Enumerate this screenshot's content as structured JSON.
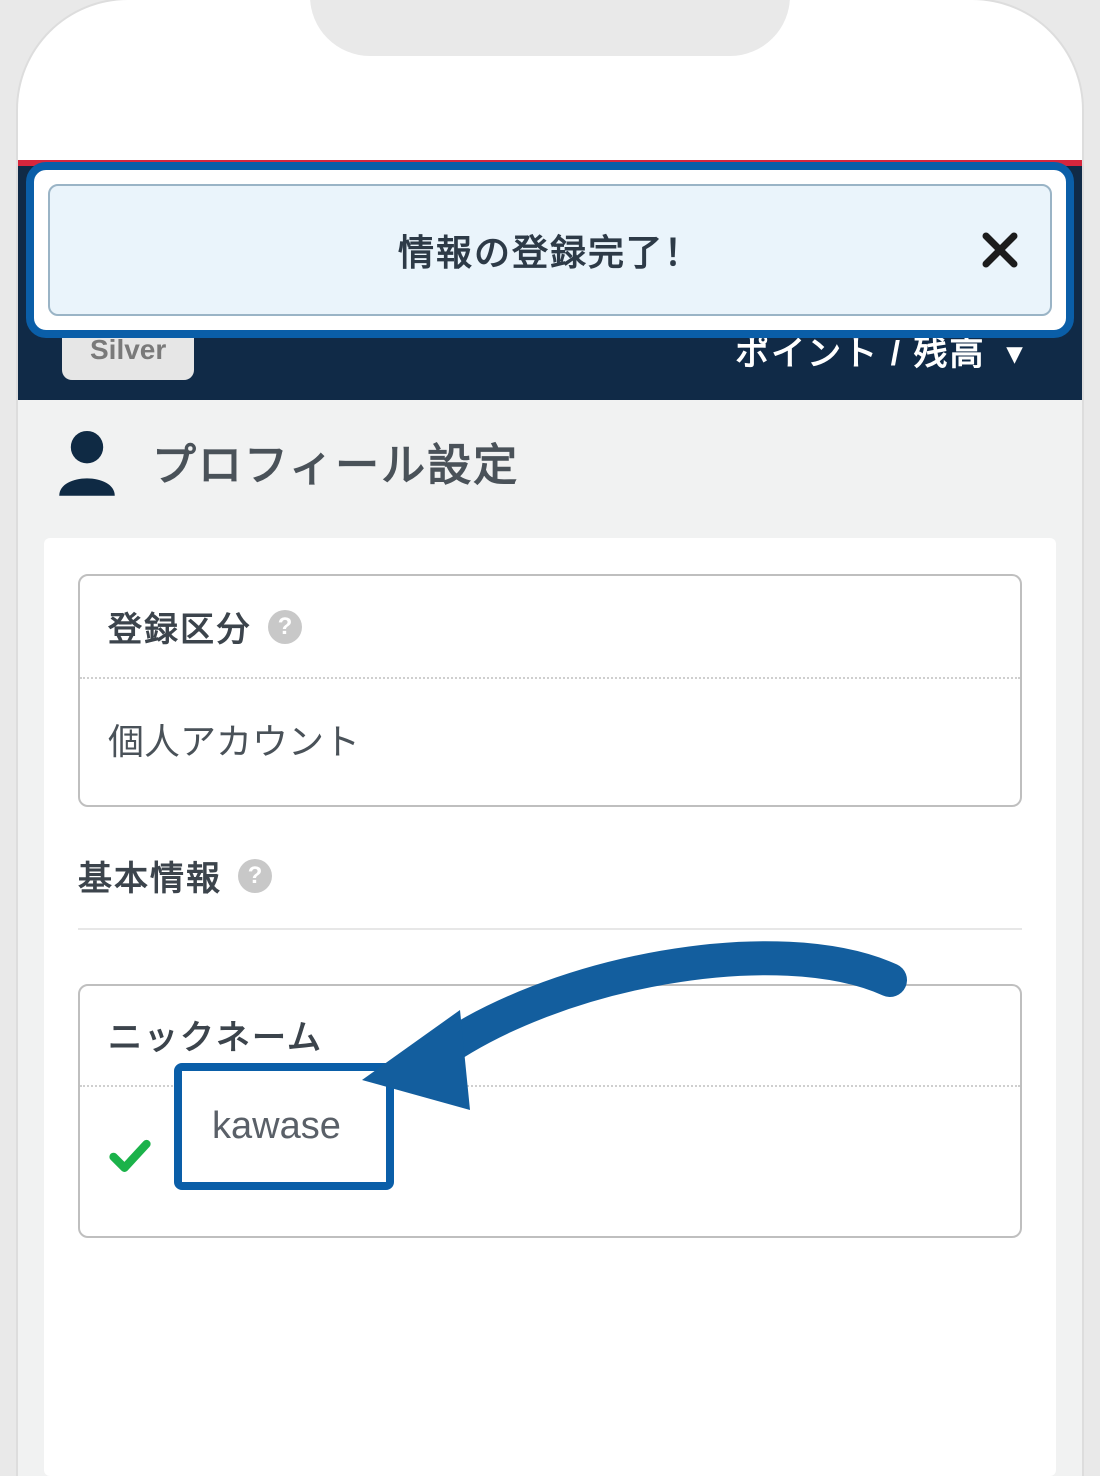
{
  "banner": {
    "message": "情報の登録完了！"
  },
  "header": {
    "tier": "Silver",
    "points_label": "ポイント / 残高"
  },
  "page": {
    "title": "プロフィール設定"
  },
  "registration_type": {
    "label": "登録区分",
    "value": "個人アカウント"
  },
  "basic_info": {
    "label": "基本情報"
  },
  "nickname": {
    "label": "ニックネーム",
    "value": "kawase"
  },
  "colors": {
    "accent": "#0a5ea8",
    "dark_header": "#102a47",
    "red": "#d7263d",
    "arrow": "#135e9e",
    "success": "#1bb24a"
  }
}
